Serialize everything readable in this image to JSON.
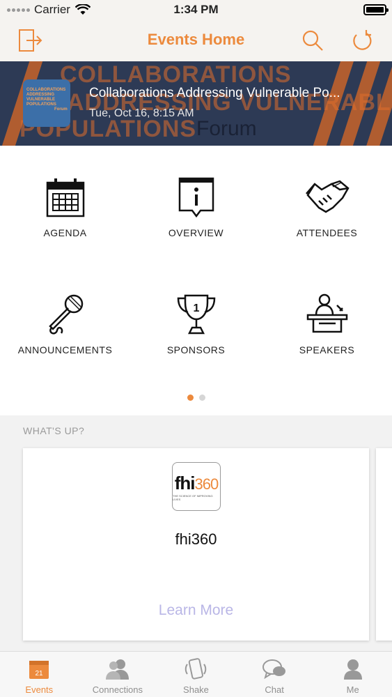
{
  "status_bar": {
    "carrier": "Carrier",
    "time": "1:34 PM"
  },
  "nav": {
    "title": "Events Home",
    "left_icon": "exit-icon",
    "right_icons": [
      "search-icon",
      "refresh-icon"
    ],
    "accent_color": "#ec8a3d"
  },
  "event": {
    "title": "Collaborations Addressing Vulnerable Po...",
    "date": "Tue, Oct 16, 8:15 AM",
    "banner_lines": [
      "COLLABORATIONS",
      "ADDRESSING VULNERABLE",
      "POPULATIONS"
    ],
    "banner_forum": "Forum",
    "thumb_lines": [
      "COLLABORATIONS",
      "ADDRESSING",
      "VULNERABLE",
      "POPULATIONS",
      "Forum"
    ]
  },
  "menu": {
    "items": [
      {
        "label": "AGENDA",
        "icon": "calendar-icon"
      },
      {
        "label": "OVERVIEW",
        "icon": "info-icon"
      },
      {
        "label": "ATTENDEES",
        "icon": "handshake-icon"
      },
      {
        "label": "ANNOUNCEMENTS",
        "icon": "microphone-icon"
      },
      {
        "label": "SPONSORS",
        "icon": "trophy-icon"
      },
      {
        "label": "SPEAKERS",
        "icon": "podium-icon"
      }
    ],
    "page_count": 2,
    "current_page": 1
  },
  "whats_up": {
    "heading": "WHAT'S UP?",
    "card": {
      "logo_text": "fhi",
      "logo_number": "360",
      "logo_tagline": "THE SCIENCE OF IMPROVING LIVES",
      "name": "fhi360",
      "link": "Learn More"
    }
  },
  "tabs": [
    {
      "label": "Events",
      "icon": "calendar-icon",
      "badge": "21",
      "active": true
    },
    {
      "label": "Connections",
      "icon": "people-icon",
      "active": false
    },
    {
      "label": "Shake",
      "icon": "phone-shake-icon",
      "active": false
    },
    {
      "label": "Chat",
      "icon": "chat-icon",
      "active": false
    },
    {
      "label": "Me",
      "icon": "person-icon",
      "active": false
    }
  ]
}
